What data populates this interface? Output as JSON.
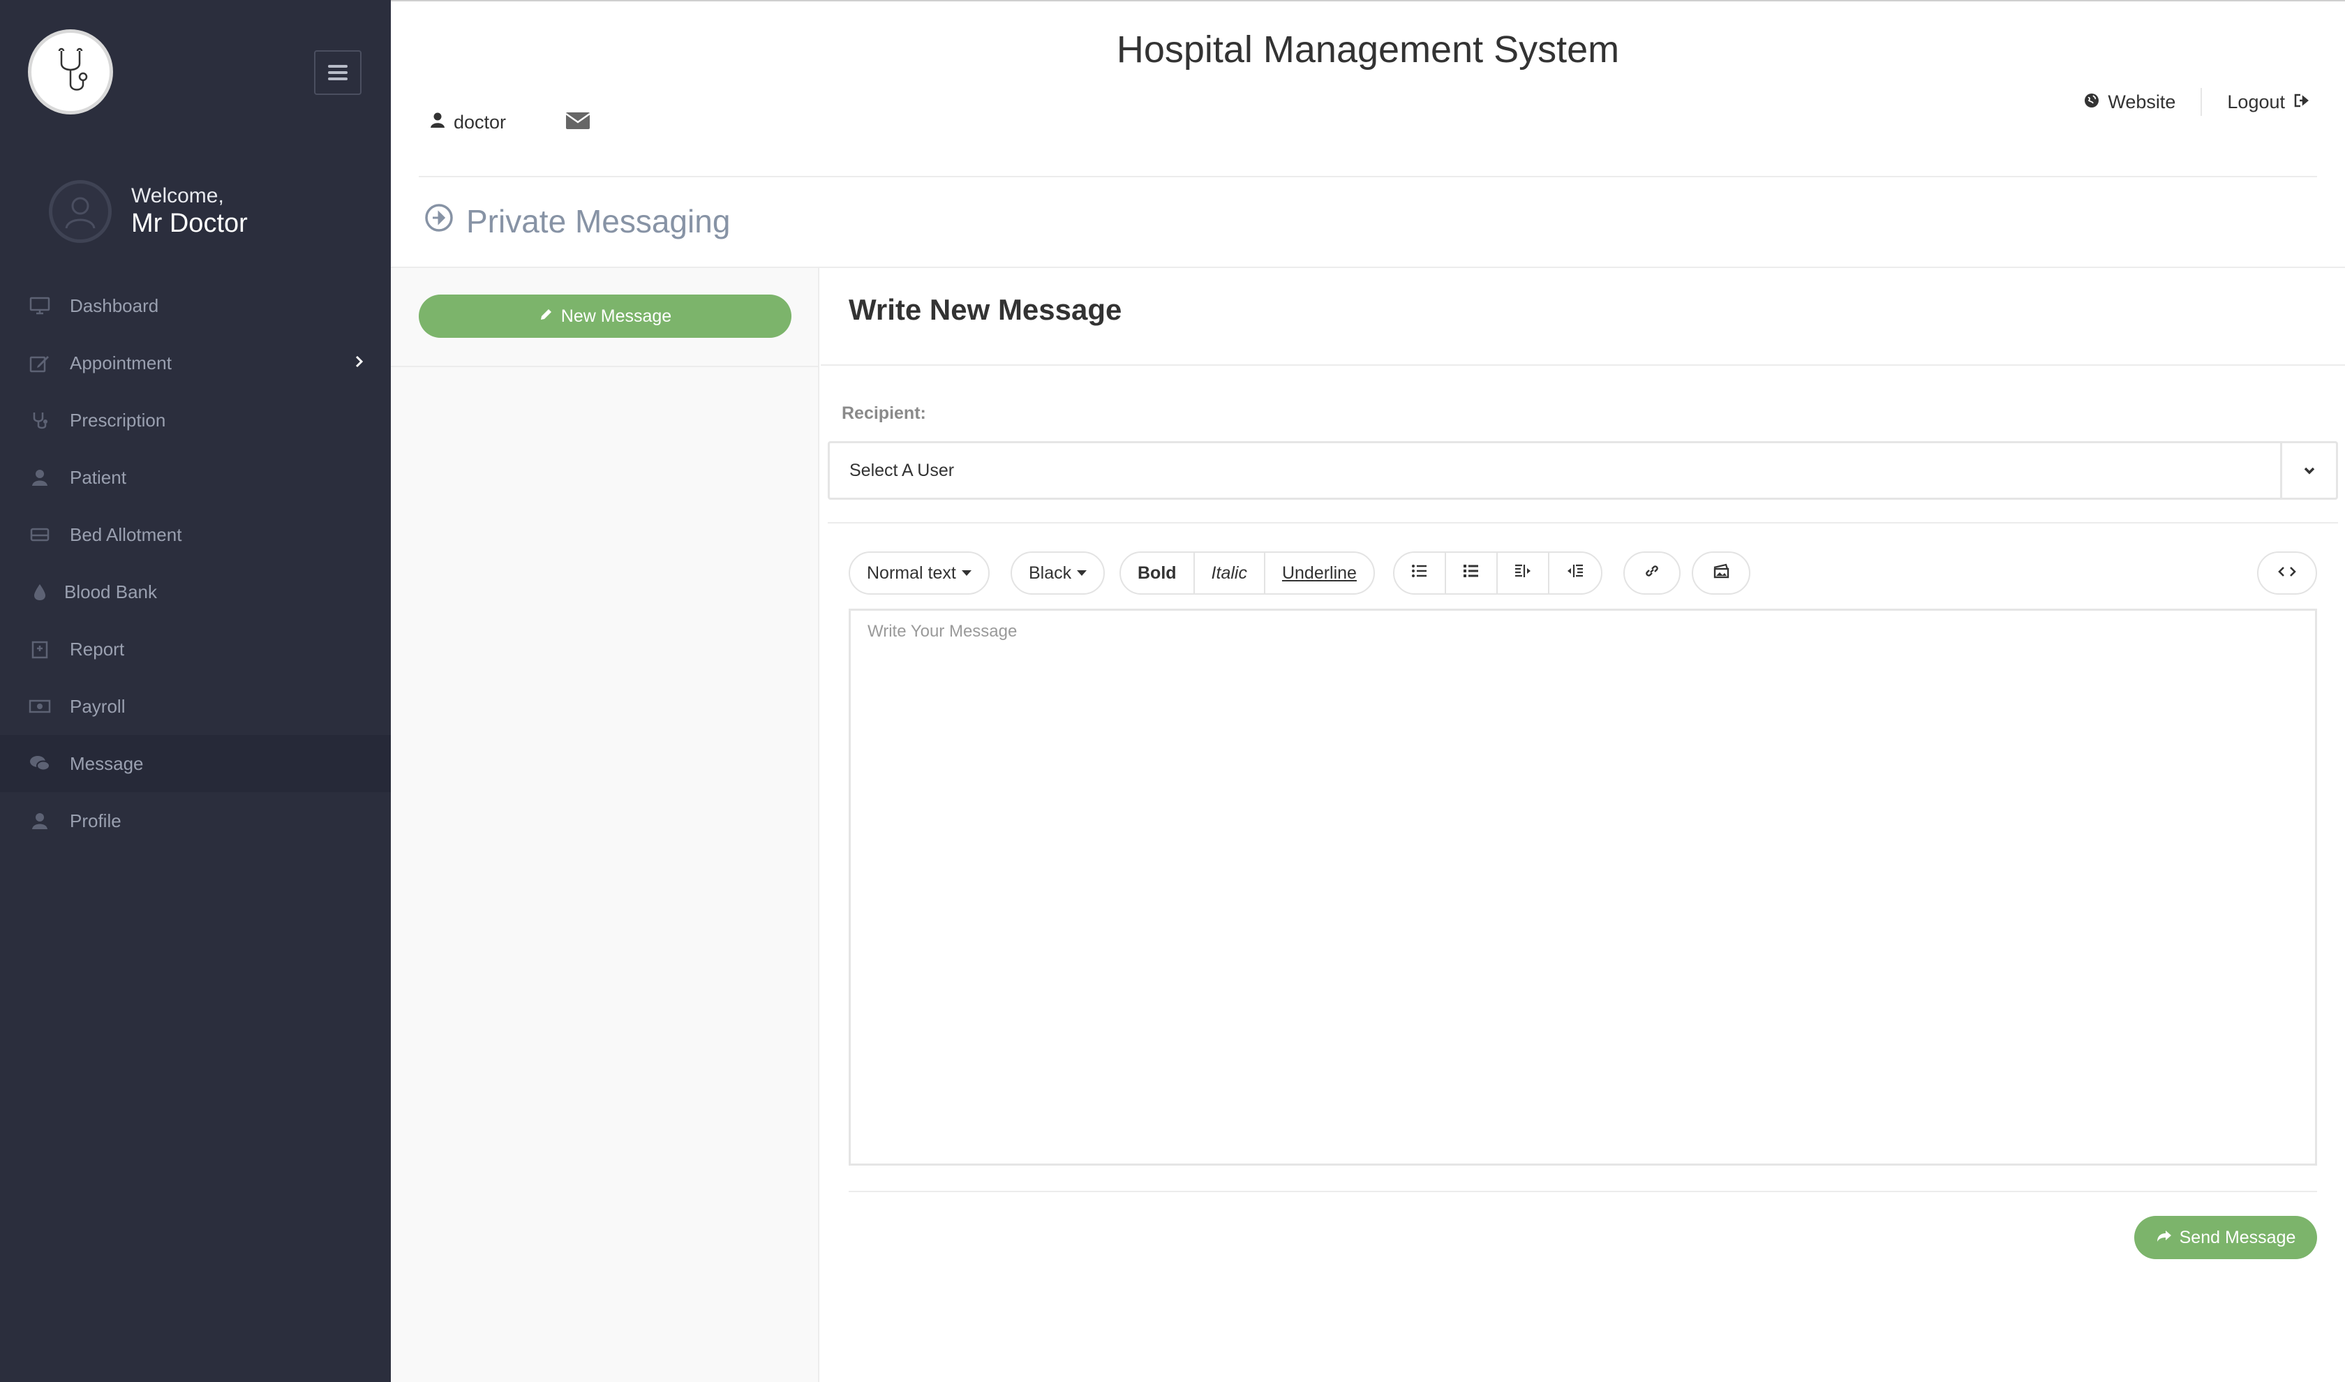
{
  "app": {
    "title": "Hospital Management System"
  },
  "header": {
    "username": "doctor",
    "website_label": "Website",
    "logout_label": "Logout"
  },
  "sidebar": {
    "welcome": "Welcome,",
    "user_name": "Mr Doctor",
    "items": [
      {
        "label": "Dashboard",
        "icon": "monitor-icon"
      },
      {
        "label": "Appointment",
        "icon": "edit-icon"
      },
      {
        "label": "Prescription",
        "icon": "stethoscope-icon"
      },
      {
        "label": "Patient",
        "icon": "user-icon"
      },
      {
        "label": "Bed Allotment",
        "icon": "bed-icon"
      },
      {
        "label": "Blood Bank",
        "icon": "drop-icon"
      },
      {
        "label": "Report",
        "icon": "hospital-icon"
      },
      {
        "label": "Payroll",
        "icon": "money-icon"
      },
      {
        "label": "Message",
        "icon": "chat-icon"
      },
      {
        "label": "Profile",
        "icon": "user-icon"
      }
    ],
    "active_item": "Message"
  },
  "page": {
    "title": "Private Messaging"
  },
  "left": {
    "new_message_label": "New Message"
  },
  "compose": {
    "title": "Write New Message",
    "recipient_label": "Recipient:",
    "recipient_value": "Select A User",
    "toolbar": {
      "text_style": "Normal text",
      "color": "Black",
      "bold": "Bold",
      "italic": "Italic",
      "underline": "Underline"
    },
    "message_placeholder": "Write Your Message",
    "send_label": "Send Message"
  },
  "colors": {
    "sidebar_bg": "#2b2e3d",
    "accent_green": "#7cb46b",
    "title_gray": "#8793a5"
  }
}
